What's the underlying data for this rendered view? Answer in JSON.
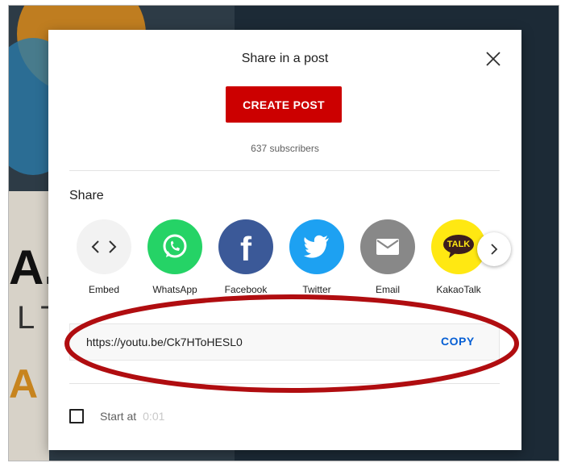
{
  "dialog": {
    "title": "Share in a post",
    "create_post_label": "CREATE POST",
    "subscribers": "637 subscribers",
    "share_label": "Share",
    "close_icon": "close-icon"
  },
  "share_targets": [
    {
      "label": "Embed",
      "icon": "embed-icon",
      "color": "#f2f2f2"
    },
    {
      "label": "WhatsApp",
      "icon": "whatsapp-icon",
      "color": "#25d366"
    },
    {
      "label": "Facebook",
      "icon": "facebook-icon",
      "color": "#3b5998"
    },
    {
      "label": "Twitter",
      "icon": "twitter-icon",
      "color": "#1da1f2"
    },
    {
      "label": "Email",
      "icon": "email-icon",
      "color": "#888888"
    },
    {
      "label": "KakaoTalk",
      "icon": "kakaotalk-icon",
      "color": "#ffe812",
      "badge_text": "TALK"
    }
  ],
  "link": {
    "url": "https://youtu.be/Ck7HToHESL0",
    "copy_label": "COPY"
  },
  "start_at": {
    "label": "Start at",
    "time": "0:01",
    "checked": false
  },
  "annotation": {
    "color": "#b00d10"
  },
  "colors": {
    "accent_red": "#cc0000",
    "link_blue": "#065fd4"
  }
}
